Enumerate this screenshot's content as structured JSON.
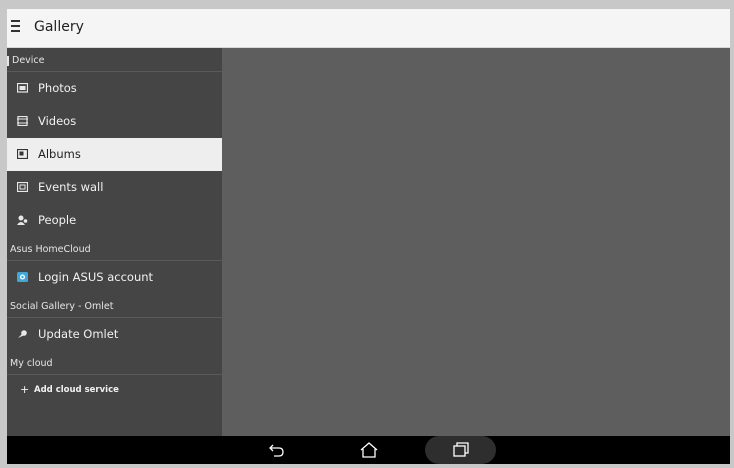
{
  "app": {
    "title": "Gallery"
  },
  "drawer": {
    "device": {
      "header": "Device",
      "items": [
        {
          "label": "Photos",
          "icon": "photos-icon"
        },
        {
          "label": "Videos",
          "icon": "videos-icon"
        },
        {
          "label": "Albums",
          "icon": "albums-icon",
          "selected": true
        },
        {
          "label": "Events wall",
          "icon": "events-wall-icon"
        },
        {
          "label": "People",
          "icon": "people-icon"
        }
      ]
    },
    "homecloud": {
      "header": "Asus HomeCloud",
      "items": [
        {
          "label": "Login ASUS account",
          "icon": "homecloud-icon"
        }
      ]
    },
    "social": {
      "header": "Social Gallery - Omlet",
      "items": [
        {
          "label": "Update Omlet",
          "icon": "omlet-icon"
        }
      ]
    },
    "mycloud": {
      "header": "My cloud",
      "items": [
        {
          "label": "Add cloud service",
          "icon": "plus-icon"
        }
      ]
    }
  },
  "navbar": {
    "buttons": [
      "back-icon",
      "home-icon",
      "recents-icon"
    ]
  },
  "colors": {
    "drawer_bg": "#454545",
    "content_bg": "#5e5e5e",
    "selected_bg": "#eeeeee",
    "appbar_bg": "#f5f5f5",
    "homecloud_icon": "#3fa8d8"
  }
}
